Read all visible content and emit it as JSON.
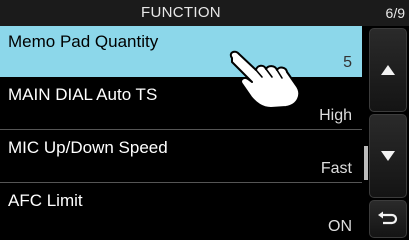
{
  "header": {
    "title": "FUNCTION",
    "page": "6/9"
  },
  "menu": {
    "items": [
      {
        "label": "Memo Pad Quantity",
        "value": "5",
        "selected": true
      },
      {
        "label": "MAIN DIAL Auto TS",
        "value": "High"
      },
      {
        "label": "MIC Up/Down Speed",
        "value": "Fast"
      },
      {
        "label": "AFC Limit",
        "value": "ON"
      }
    ]
  },
  "buttons": {
    "up": "up-arrow-icon",
    "down": "down-arrow-icon",
    "back": "return-arrow-icon"
  },
  "overlay": {
    "icon": "touch-hand-icon"
  },
  "colors": {
    "selected_bg": "#8cd7ea",
    "background": "#000000",
    "text": "#ffffff"
  }
}
